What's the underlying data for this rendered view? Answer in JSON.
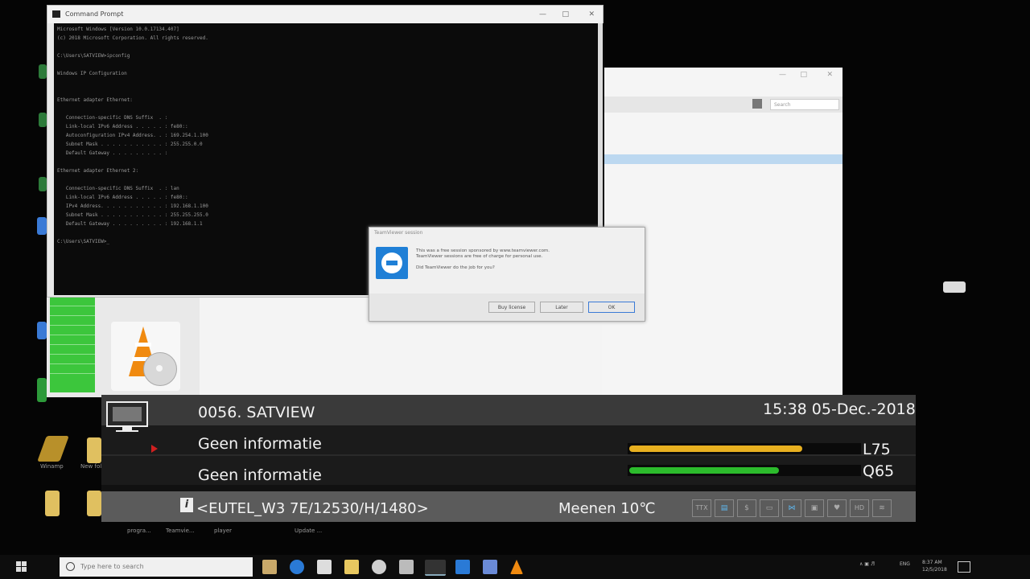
{
  "stb": {
    "channel": "0056.  SATVIEW",
    "datetime": "15:38 05-Dec.-2018",
    "info_1": "Geen informatie",
    "info_2": "Geen informatie",
    "level_label": "L75",
    "level_value": 75,
    "quality_label": "Q65",
    "quality_value": 65,
    "transponder": "<EUTEL_W3 7E/12530/H/1480>",
    "weather": "Meenen 10℃",
    "status_icons": [
      "TTX",
      "EPG",
      "$",
      "SUB",
      "RADIO",
      "LOCK",
      "FAV",
      "HD",
      "WIFI"
    ],
    "colors": {
      "level": "#e8b020",
      "quality": "#2cbb2c"
    }
  },
  "cmd": {
    "title": "Command Prompt",
    "lines": [
      "Microsoft Windows [Version 10.0.17134.407]",
      "(c) 2018 Microsoft Corporation. All rights reserved.",
      "",
      "C:\\Users\\SATVIEW>ipconfig",
      "",
      "Windows IP Configuration",
      "",
      "",
      "Ethernet adapter Ethernet:",
      "",
      "   Connection-specific DNS Suffix  . :",
      "   Link-local IPv6 Address . . . . . : fe80::",
      "   Autoconfiguration IPv4 Address. . : 169.254.1.100",
      "   Subnet Mask . . . . . . . . . . . : 255.255.0.0",
      "   Default Gateway . . . . . . . . . :",
      "",
      "Ethernet adapter Ethernet 2:",
      "",
      "   Connection-specific DNS Suffix  . : lan",
      "   Link-local IPv6 Address . . . . . : fe80::",
      "   IPv4 Address. . . . . . . . . . . : 192.168.1.100",
      "   Subnet Mask . . . . . . . . . . . : 255.255.255.0",
      "   Default Gateway . . . . . . . . . : 192.168.1.1",
      "",
      "C:\\Users\\SATVIEW>_"
    ]
  },
  "dialog": {
    "title": "TeamViewer session",
    "message_1": "This was a free session sponsored by www.teamviewer.com.",
    "message_2": "TeamViewer sessions are free of charge for personal use.",
    "message_3": "Did TeamViewer do the job for you?",
    "buttons": [
      "Buy license",
      "Later",
      "OK"
    ]
  },
  "window2": {
    "search_placeholder": "Search"
  },
  "desktop": {
    "icons": [
      "Winamp",
      "New folder",
      "",
      "",
      "progra...",
      "Teamvie...",
      "player",
      "Update ..."
    ]
  },
  "taskbar": {
    "search_placeholder": "Type here to search",
    "tray_lang": "ENG",
    "tray_time": "8:37 AM",
    "tray_date": "12/5/2018"
  }
}
